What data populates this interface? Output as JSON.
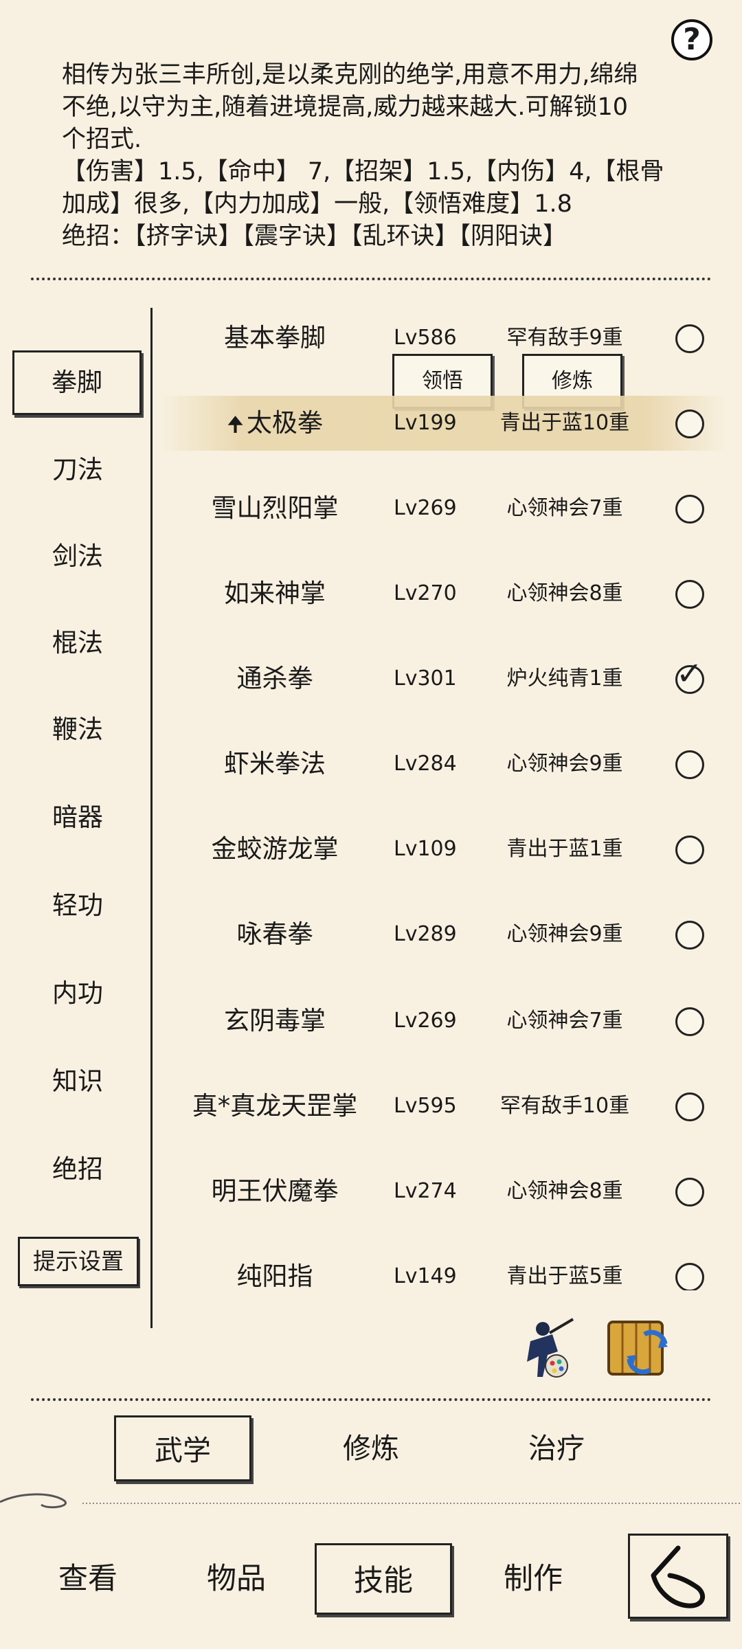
{
  "help": {
    "icon": "question-mark-icon",
    "glyph": "?"
  },
  "description": {
    "line1": "相传为张三丰所创,是以柔克刚的绝学,用意不用力,绵绵",
    "line2": "不绝,以守为主,随着进境提高,威力越来越大.可解锁10",
    "line3": "个招式.",
    "line4": "【伤害】1.5,【命中】 7,【招架】1.5,【内伤】4,【根骨",
    "line5": "加成】很多,【内力加成】一般,【领悟难度】1.8",
    "line6": "绝招：【挤字诀】【震字诀】【乱环诀】【阴阳诀】"
  },
  "categories": [
    "拳脚",
    "刀法",
    "剑法",
    "棍法",
    "鞭法",
    "暗器",
    "轻功",
    "内功",
    "知识",
    "绝招"
  ],
  "tip_settings": "提示设置",
  "actions": {
    "comprehend": "领悟",
    "train": "修炼"
  },
  "skills": [
    {
      "name": "基本拳脚",
      "level": "Lv586",
      "stage": "罕有敌手9重",
      "checked": false
    },
    {
      "name": "太极拳",
      "level": "Lv199",
      "stage": "青出于蓝10重",
      "checked": false,
      "upgrade_arrow": "🠉"
    },
    {
      "name": "雪山烈阳掌",
      "level": "Lv269",
      "stage": "心领神会7重",
      "checked": false
    },
    {
      "name": "如来神掌",
      "level": "Lv270",
      "stage": "心领神会8重",
      "checked": false
    },
    {
      "name": "通杀拳",
      "level": "Lv301",
      "stage": "炉火纯青1重",
      "checked": true
    },
    {
      "name": "虾米拳法",
      "level": "Lv284",
      "stage": "心领神会9重",
      "checked": false
    },
    {
      "name": "金蛟游龙掌",
      "level": "Lv109",
      "stage": "青出于蓝1重",
      "checked": false
    },
    {
      "name": "咏春拳",
      "level": "Lv289",
      "stage": "心领神会9重",
      "checked": false
    },
    {
      "name": "玄阴毒掌",
      "level": "Lv269",
      "stage": "心领神会7重",
      "checked": false
    },
    {
      "name": "真*真龙天罡掌",
      "level": "Lv595",
      "stage": "罕有敌手10重",
      "checked": false
    },
    {
      "name": "明王伏魔拳",
      "level": "Lv274",
      "stage": "心领神会8重",
      "checked": false
    },
    {
      "name": "纯阳指",
      "level": "Lv149",
      "stage": "青出于蓝5重",
      "checked": false
    }
  ],
  "check_glyph": "✓",
  "tool_icons": [
    "ninja-painter-icon",
    "scroll-refresh-icon"
  ],
  "sub_tabs": [
    "武学",
    "修炼",
    "治疗"
  ],
  "nav_tabs": [
    "查看",
    "物品",
    "技能",
    "制作"
  ],
  "back_icon": "back-arrow-icon"
}
